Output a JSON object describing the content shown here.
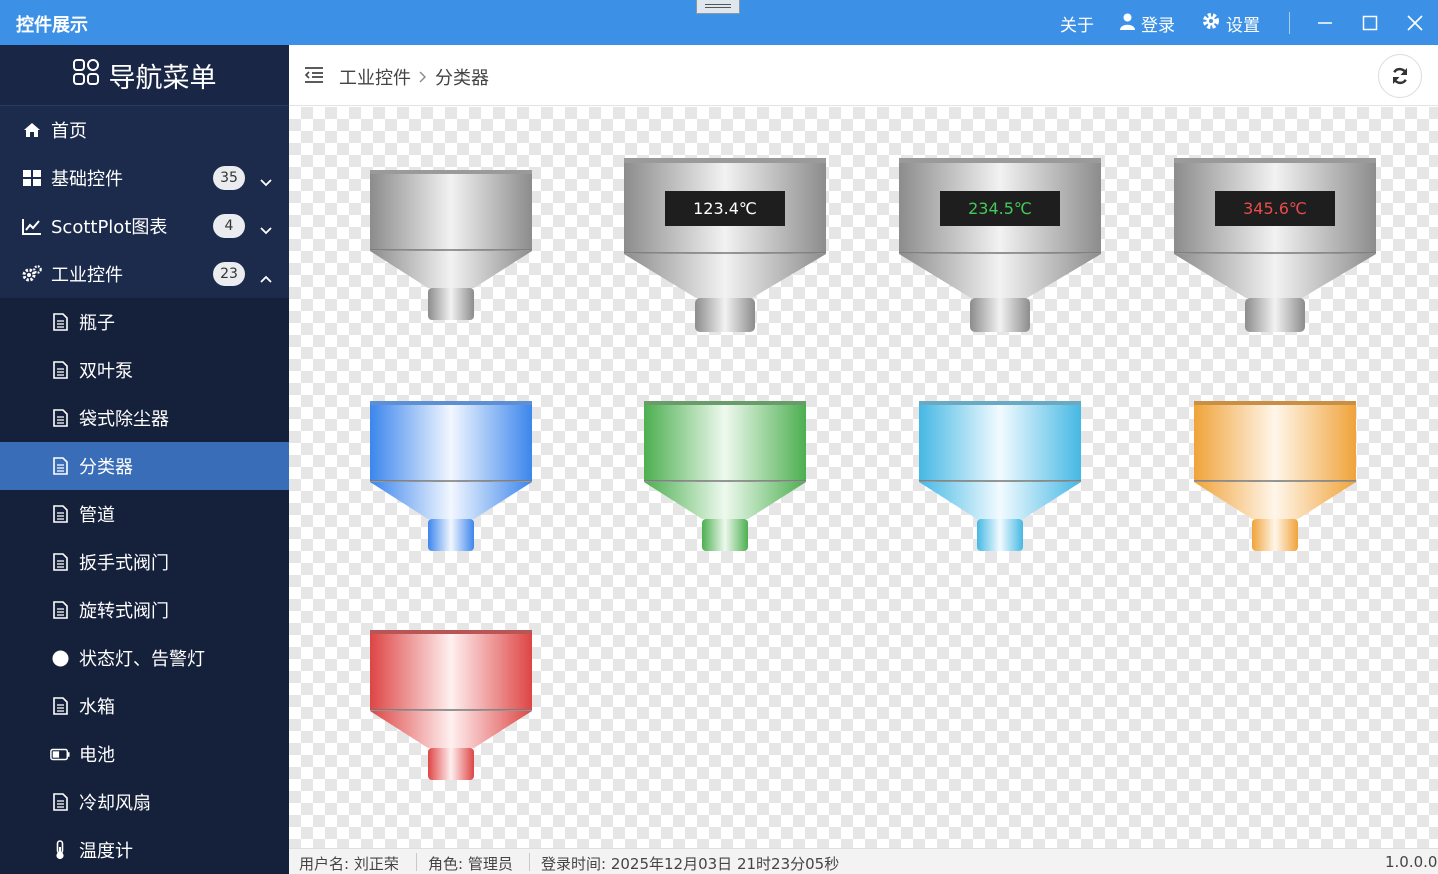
{
  "window": {
    "title": "控件展示",
    "about": "关于",
    "login": "登录",
    "settings": "设置"
  },
  "sidebar": {
    "header": "导航菜单",
    "items": [
      {
        "label": "首页",
        "icon": "home-icon"
      },
      {
        "label": "基础控件",
        "icon": "grid-icon",
        "badge": "35",
        "expanded": false
      },
      {
        "label": "ScottPlot图表",
        "icon": "line-chart-icon",
        "badge": "4",
        "expanded": false
      },
      {
        "label": "工业控件",
        "icon": "gears-icon",
        "badge": "23",
        "expanded": true
      }
    ],
    "subitems": [
      {
        "label": "瓶子",
        "icon": "document-icon"
      },
      {
        "label": "双叶泵",
        "icon": "document-icon"
      },
      {
        "label": "袋式除尘器",
        "icon": "document-icon"
      },
      {
        "label": "分类器",
        "icon": "document-icon",
        "active": true
      },
      {
        "label": "管道",
        "icon": "document-icon"
      },
      {
        "label": "扳手式阀门",
        "icon": "document-icon"
      },
      {
        "label": "旋转式阀门",
        "icon": "document-icon"
      },
      {
        "label": "状态灯、告警灯",
        "icon": "circle-icon"
      },
      {
        "label": "水箱",
        "icon": "document-icon"
      },
      {
        "label": "电池",
        "icon": "battery-icon"
      },
      {
        "label": "冷却风扇",
        "icon": "document-icon"
      },
      {
        "label": "温度计",
        "icon": "thermometer-icon"
      }
    ]
  },
  "breadcrumb": {
    "parent": "工业控件",
    "current": "分类器"
  },
  "separators": [
    {
      "color": "silver",
      "display": ""
    },
    {
      "color": "silver",
      "display": "123.4℃",
      "text_color": "#ffffff"
    },
    {
      "color": "silver",
      "display": "234.5℃",
      "text_color": "#46c85a"
    },
    {
      "color": "silver",
      "display": "345.6℃",
      "text_color": "#e84c4c"
    },
    {
      "color": "blue"
    },
    {
      "color": "green"
    },
    {
      "color": "cyan"
    },
    {
      "color": "orange"
    },
    {
      "color": "red"
    }
  ],
  "status": {
    "user": "用户名: 刘正荣",
    "role": "角色: 管理员",
    "login_time": "登录时间: 2025年12月03日 21时23分05秒",
    "version": "1.0.0.0"
  }
}
